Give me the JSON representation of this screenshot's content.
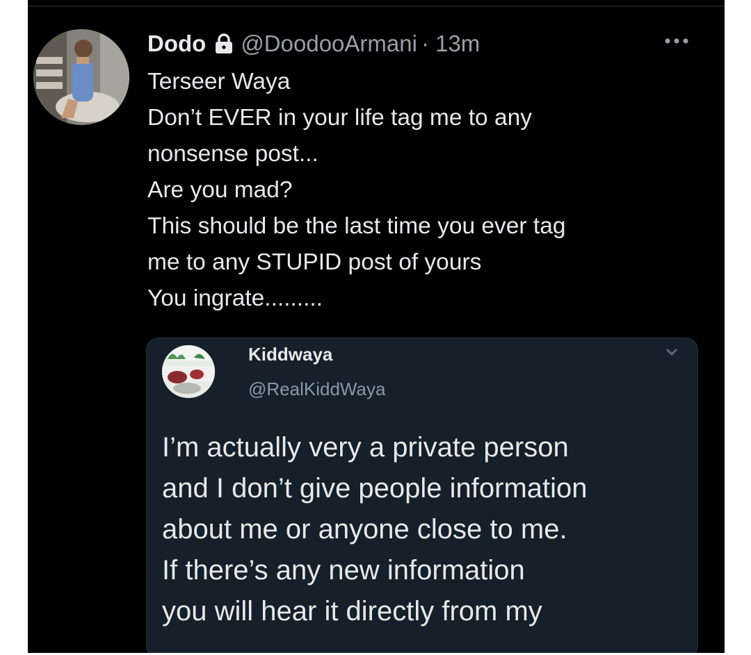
{
  "tweet": {
    "display_name": "Dodo",
    "handle": "@DoodooArmani",
    "time": "· 13m",
    "lines": [
      "Terseer Waya",
      "Don’t EVER in your life tag me to any",
      "nonsense post...",
      "Are you mad?",
      "This should be the last time you ever tag",
      "me to any STUPID post of yours",
      "You ingrate........."
    ]
  },
  "quoted": {
    "display_name": "Kiddwaya",
    "handle": "@RealKiddWaya",
    "lines": [
      "I’m actually very a private person",
      "and I don’t give people information",
      "about me or anyone close to me.",
      "If there’s any new information",
      "you will hear it directly from my"
    ]
  },
  "colors": {
    "background": "#000000",
    "quote_background": "#15202b",
    "text": "#e7e9ea",
    "secondary_text": "#9aa0a6"
  },
  "icons": [
    "lock-icon",
    "more-options-icon",
    "chevron-down-icon"
  ]
}
